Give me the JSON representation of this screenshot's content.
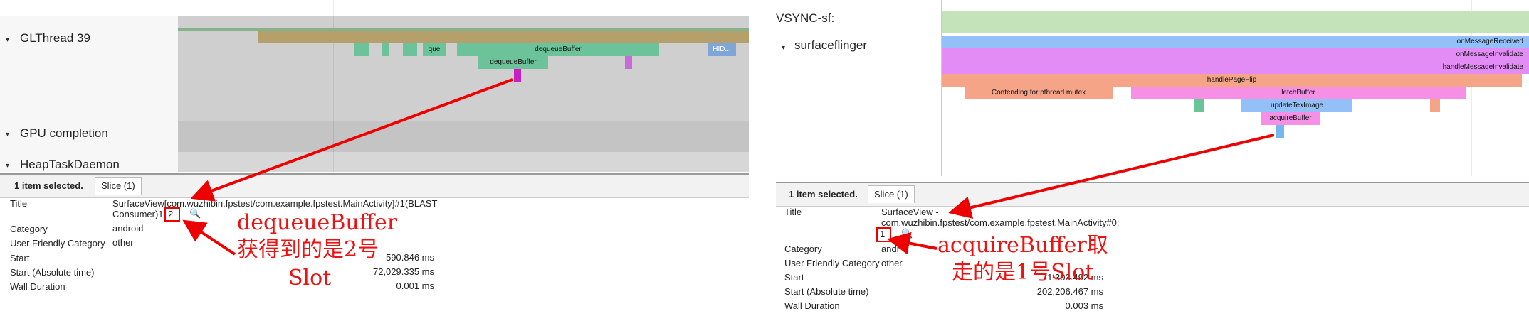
{
  "left": {
    "tracks": [
      {
        "label": "GLThread 39",
        "expander": "▾"
      },
      {
        "label": "GPU completion",
        "expander": "▾"
      },
      {
        "label": "HeapTaskDaemon",
        "expander": "▾"
      }
    ],
    "slices": {
      "que": "que",
      "dequeue_outer": "dequeueBuffer",
      "dequeue_inner": "dequeueBuffer",
      "hid": "HID..."
    },
    "details": {
      "selected_text": "1 item selected.",
      "tab_label": "Slice (1)",
      "title_label": "Title",
      "title_value_line1": "SurfaceView[com.wuzhibin.fpstest/com.example.fpstest.MainActivity]#1(BLAST",
      "title_value_line2": "Consumer)1:",
      "slot_number": "2",
      "category_label": "Category",
      "category_value": "android",
      "ufc_label": "User Friendly Category",
      "ufc_value": "other",
      "start_label": "Start",
      "start_value": "590.846 ms",
      "start_abs_label": "Start (Absolute time)",
      "start_abs_value": "72,029.335 ms",
      "wall_label": "Wall Duration",
      "wall_value": "0.001 ms"
    },
    "annotation": {
      "line1": "dequeueBuffer",
      "line2": "获得到的是2号",
      "line3": "Slot"
    }
  },
  "right": {
    "tracks": [
      {
        "label": "VSYNC-sf:",
        "expander": ""
      },
      {
        "label": "surfaceflinger",
        "expander": "▾"
      }
    ],
    "slices": {
      "on_message_received": "onMessageReceived",
      "on_message_invalidate": "onMessageInvalidate",
      "handle_message_invalidate": "handleMessageInvalidate",
      "handle_page_flip": "handlePageFlip",
      "contending": "Contending for pthread mutex",
      "latch_buffer": "latchBuffer",
      "update_tex_image": "updateTexImage",
      "acquire_buffer": "acquireBuffer"
    },
    "details": {
      "selected_text": "1 item selected.",
      "tab_label": "Slice (1)",
      "title_label": "Title",
      "title_value_line1": "SurfaceView -",
      "title_value_line2": "com.wuzhibin.fpstest/com.example.fpstest.MainActivity#0:",
      "slot_number": "1",
      "category_label": "Category",
      "category_value": "andr",
      "ufc_label": "User Friendly Category",
      "ufc_value": "other",
      "start_label": "Start",
      "start_value": "1,303.492 ms",
      "start_abs_label": "Start (Absolute time)",
      "start_abs_value": "202,206.467 ms",
      "wall_label": "Wall Duration",
      "wall_value": "0.003 ms"
    },
    "annotation": {
      "line1": "acquireBuffer取",
      "line2": "走的是1号Slot"
    }
  },
  "colors": {
    "annotation_red": "#ee1111",
    "teal_slice": "#6cc39a",
    "tan_slice": "#b5a06c",
    "pink_slice": "#f590e6",
    "magenta_slice": "#e38cf5",
    "blue_slice": "#92c0f7",
    "salmon_slice": "#f5a488",
    "vsync_green": "#c5e3bb"
  },
  "icons": [
    "magnifier-icon",
    "expander-icon"
  ]
}
